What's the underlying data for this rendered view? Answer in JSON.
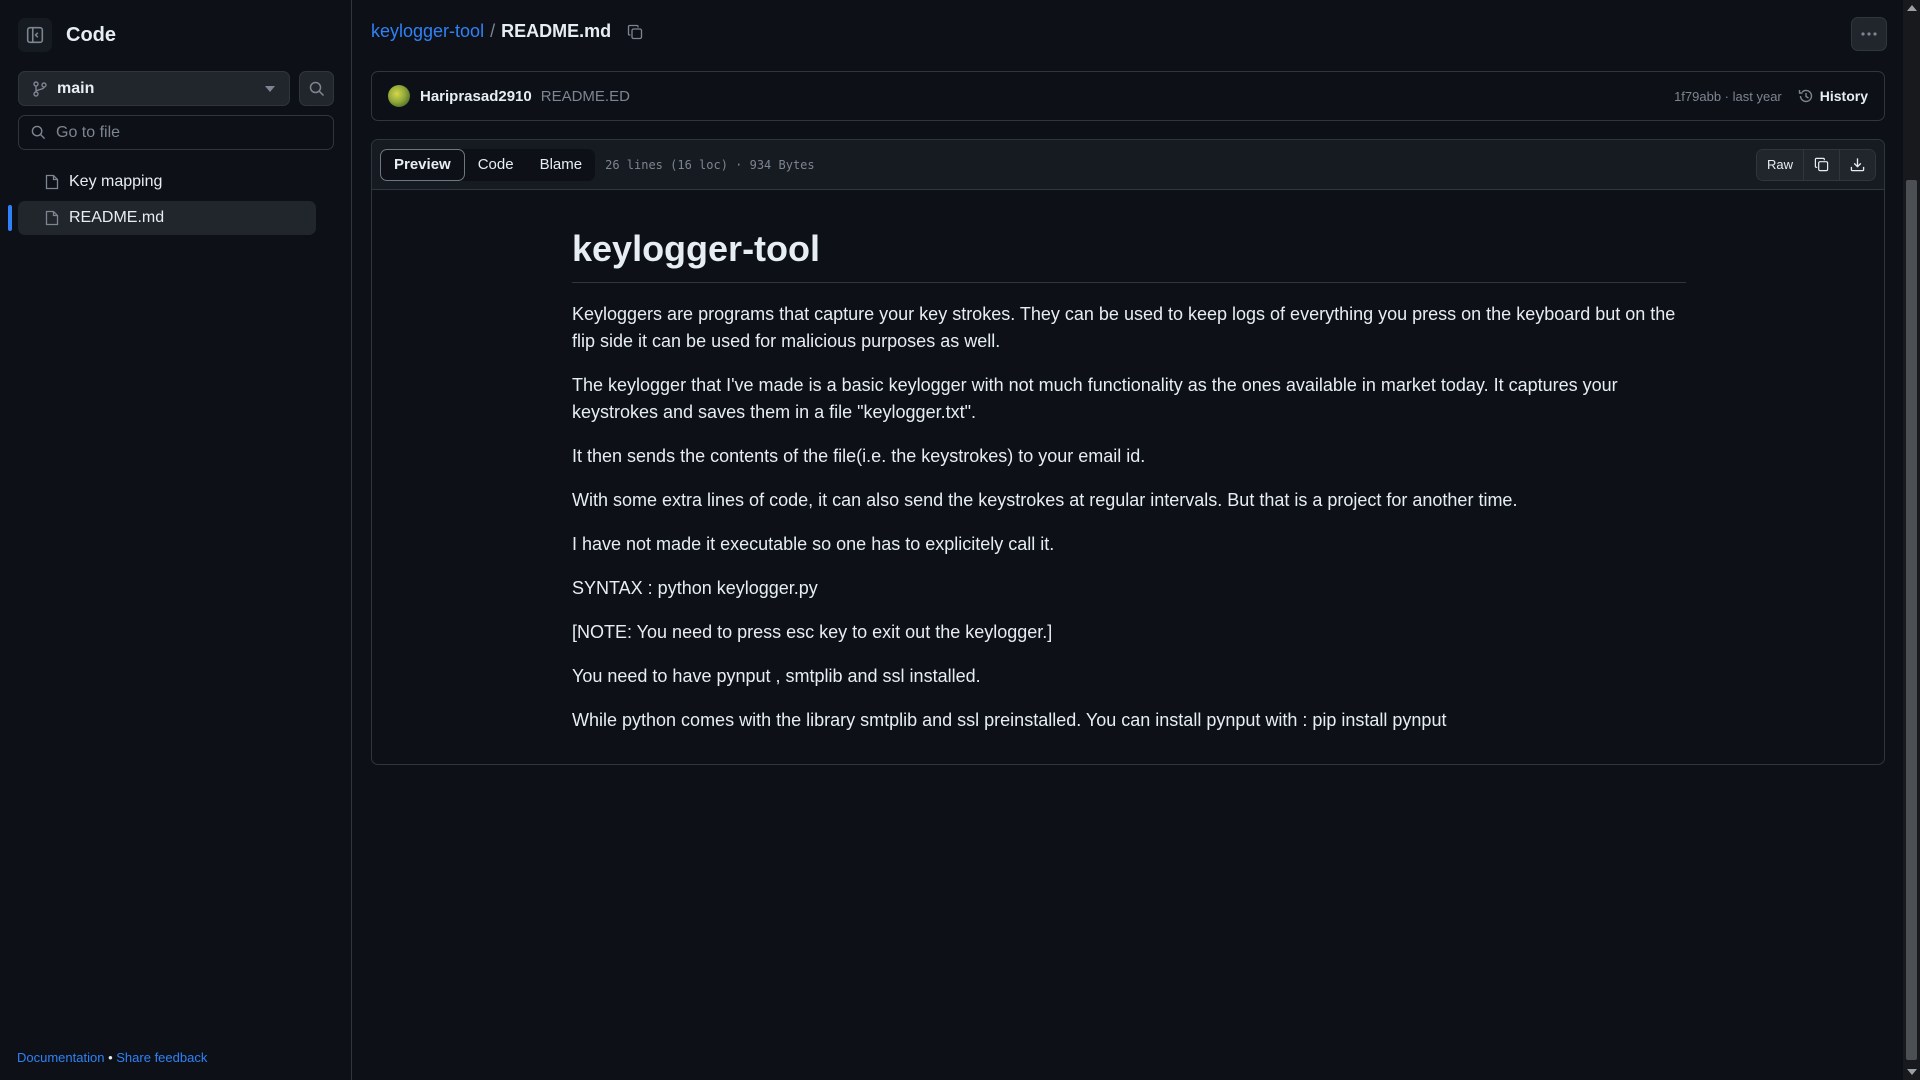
{
  "sidebar": {
    "title": "Code",
    "branch": "main",
    "goto_placeholder": "Go to file",
    "files": [
      {
        "label": "Key mapping"
      },
      {
        "label": "README.md"
      }
    ],
    "footer": {
      "documentation": "Documentation",
      "separator": "•",
      "feedback": "Share feedback"
    }
  },
  "breadcrumb": {
    "repo": "keylogger-tool",
    "separator": "/",
    "file": "README.md"
  },
  "commit": {
    "author": "Hariprasad2910",
    "message": "README.ED",
    "meta": "1f79abb · last year",
    "history_label": "History"
  },
  "toolbar": {
    "tabs": [
      "Preview",
      "Code",
      "Blame"
    ],
    "file_info": "26 lines (16 loc) · 934 Bytes",
    "raw_label": "Raw"
  },
  "readme": {
    "title": "keylogger-tool",
    "paragraphs": [
      "Keyloggers are programs that capture your key strokes. They can be used to keep logs of everything you press on the keyboard but on the flip side it can be used for malicious purposes as well.",
      "The keylogger that I've made is a basic keylogger with not much functionality as the ones available in market today. It captures your keystrokes and saves them in a file \"keylogger.txt\".",
      "It then sends the contents of the file(i.e. the keystrokes) to your email id.",
      "With some extra lines of code, it can also send the keystrokes at regular intervals. But that is a project for another time.",
      "I have not made it executable so one has to explicitely call it.",
      "SYNTAX : python keylogger.py",
      "[NOTE: You need to press esc key to exit out the keylogger.]",
      "You need to have pynput , smtplib and ssl installed.",
      "While python comes with the library smtplib and ssl preinstalled. You can install pynput with : pip install pynput"
    ]
  },
  "colors": {
    "background": "#0d1117",
    "accent": "#2f81f7",
    "border": "#30363d",
    "muted": "#7d8590"
  }
}
